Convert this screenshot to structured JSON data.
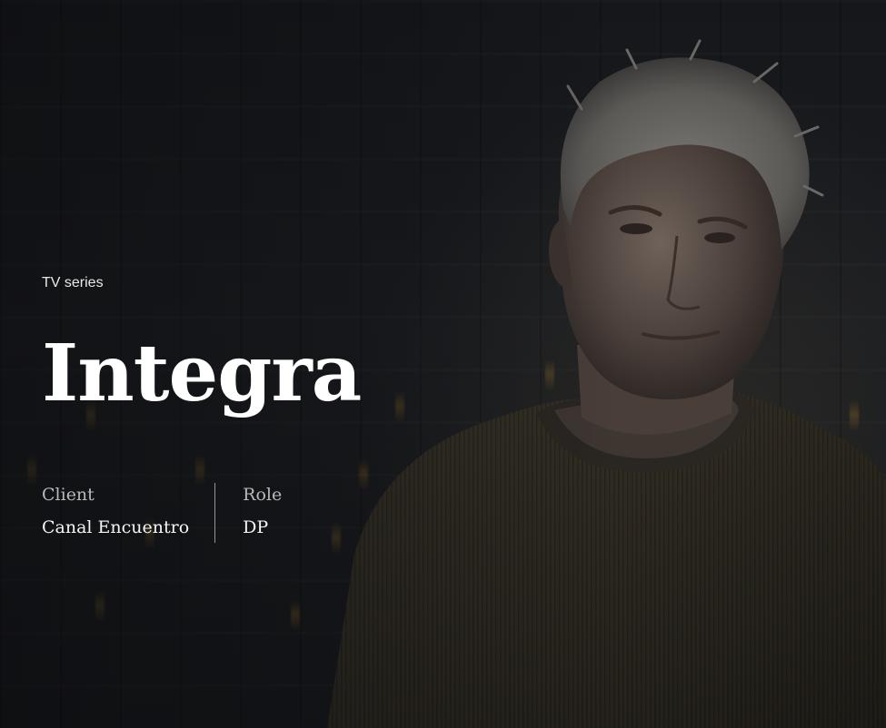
{
  "project": {
    "category": "TV series",
    "title": "Integra",
    "client_label": "Client",
    "client_value": "Canal Encuentro",
    "role_label": "Role",
    "role_value": "DP"
  },
  "colors": {
    "background": "#16181c",
    "text_primary": "#ffffff",
    "text_muted": "#b9b9b9"
  }
}
